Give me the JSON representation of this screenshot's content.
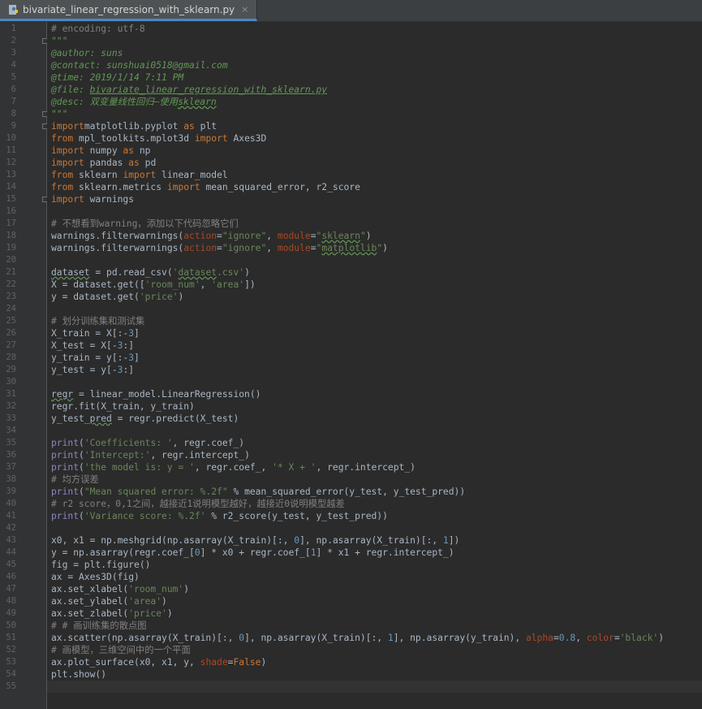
{
  "tab": {
    "title": "bivariate_linear_regression_with_sklearn.py",
    "close_glyph": "×",
    "icon": "python-file-icon"
  },
  "editor": {
    "current_line": 55,
    "lines": [
      {
        "n": "1",
        "tokens": [
          [
            "c-com",
            "# encoding: utf-8"
          ]
        ]
      },
      {
        "n": "2",
        "tokens": [
          [
            "c-doc",
            "\"\"\""
          ]
        ]
      },
      {
        "n": "3",
        "tokens": [
          [
            "c-doctag",
            "@author: suns"
          ]
        ]
      },
      {
        "n": "4",
        "tokens": [
          [
            "c-doctag",
            "@contact: sunshuai0518@gmail.com"
          ]
        ]
      },
      {
        "n": "5",
        "tokens": [
          [
            "c-doctag",
            "@time: 2019/1/14 7:11 PM"
          ]
        ]
      },
      {
        "n": "6",
        "tokens": [
          [
            "c-doctag",
            "@file: "
          ],
          [
            "c-doctag c-under",
            "bivariate_linear_regression_with_sklearn.py"
          ]
        ]
      },
      {
        "n": "7",
        "tokens": [
          [
            "c-doctag",
            "@desc: 双变量线性回归—使用"
          ],
          [
            "c-doctag c-wavy",
            "sklearn"
          ]
        ]
      },
      {
        "n": "8",
        "tokens": [
          [
            "c-doc",
            "\"\"\""
          ]
        ]
      },
      {
        "n": "9",
        "tokens": [
          [
            "c-kw",
            "import"
          ],
          [
            "",
            "matplotlib.pyplot "
          ],
          [
            "c-kw",
            "as"
          ],
          [
            "",
            " plt"
          ]
        ]
      },
      {
        "n": "10",
        "tokens": [
          [
            "c-kw",
            "from"
          ],
          [
            "",
            " mpl_toolkits.mplot3d "
          ],
          [
            "c-kw",
            "import"
          ],
          [
            "",
            " Axes3D"
          ]
        ]
      },
      {
        "n": "11",
        "tokens": [
          [
            "c-kw",
            "import"
          ],
          [
            "",
            " numpy "
          ],
          [
            "c-kw",
            "as"
          ],
          [
            "",
            " np"
          ]
        ]
      },
      {
        "n": "12",
        "tokens": [
          [
            "c-kw",
            "import"
          ],
          [
            "",
            " pandas "
          ],
          [
            "c-kw",
            "as"
          ],
          [
            "",
            " pd"
          ]
        ]
      },
      {
        "n": "13",
        "tokens": [
          [
            "c-kw",
            "from"
          ],
          [
            "",
            " sklearn "
          ],
          [
            "c-kw",
            "import"
          ],
          [
            "",
            " linear_model"
          ]
        ]
      },
      {
        "n": "14",
        "tokens": [
          [
            "c-kw",
            "from"
          ],
          [
            "",
            " sklearn.metrics "
          ],
          [
            "c-kw",
            "import"
          ],
          [
            "",
            " mean_squared_error, r2_score"
          ]
        ]
      },
      {
        "n": "15",
        "tokens": [
          [
            "c-kw",
            "import"
          ],
          [
            "",
            " warnings"
          ]
        ]
      },
      {
        "n": "16",
        "tokens": []
      },
      {
        "n": "17",
        "tokens": [
          [
            "c-com",
            "# 不想看到warning，添加以下代码忽略它们"
          ]
        ]
      },
      {
        "n": "18",
        "tokens": [
          [
            "",
            "warnings.filterwarnings("
          ],
          [
            "c-param",
            "action"
          ],
          [
            "",
            "="
          ],
          [
            "c-str",
            "\"ignore\""
          ],
          [
            ", ",
            ""
          ],
          [
            "",
            ", "
          ],
          [
            "c-param",
            "module"
          ],
          [
            "",
            "="
          ],
          [
            "c-str",
            "\""
          ],
          [
            "c-str c-wavy",
            "sklearn"
          ],
          [
            "c-str",
            "\""
          ],
          [
            "",
            ")"
          ]
        ]
      },
      {
        "n": "19",
        "tokens": [
          [
            "",
            "warnings.filterwarnings("
          ],
          [
            "c-param",
            "action"
          ],
          [
            "",
            "="
          ],
          [
            "c-str",
            "\"ignore\""
          ],
          [
            "",
            ", "
          ],
          [
            "c-param",
            "module"
          ],
          [
            "",
            "="
          ],
          [
            "c-str",
            "\""
          ],
          [
            "c-str c-wavy",
            "matplotlib"
          ],
          [
            "c-str",
            "\""
          ],
          [
            "",
            ")"
          ]
        ]
      },
      {
        "n": "20",
        "tokens": []
      },
      {
        "n": "21",
        "tokens": [
          [
            "c-wavy",
            "dataset"
          ],
          [
            "",
            " = pd.read_csv("
          ],
          [
            "c-str",
            "'"
          ],
          [
            "c-str c-wavy",
            "dataset"
          ],
          [
            "c-str",
            ".csv'"
          ],
          [
            "",
            ")"
          ]
        ]
      },
      {
        "n": "22",
        "tokens": [
          [
            "",
            "X = dataset.get(["
          ],
          [
            "c-str",
            "'room_num'"
          ],
          [
            "",
            ", "
          ],
          [
            "c-str",
            "'area'"
          ],
          [
            "",
            "])"
          ]
        ]
      },
      {
        "n": "23",
        "tokens": [
          [
            "",
            "y = dataset.get("
          ],
          [
            "c-str",
            "'price'"
          ],
          [
            "",
            ")"
          ]
        ]
      },
      {
        "n": "24",
        "tokens": []
      },
      {
        "n": "25",
        "tokens": [
          [
            "c-com",
            "# 划分训练集和测试集"
          ]
        ]
      },
      {
        "n": "26",
        "tokens": [
          [
            "",
            "X_train = X[:-"
          ],
          [
            "c-num",
            "3"
          ],
          [
            "",
            "]"
          ]
        ]
      },
      {
        "n": "27",
        "tokens": [
          [
            "",
            "X_test = X[-"
          ],
          [
            "c-num",
            "3"
          ],
          [
            "",
            ":]"
          ]
        ]
      },
      {
        "n": "28",
        "tokens": [
          [
            "",
            "y_train = y[:-"
          ],
          [
            "c-num",
            "3"
          ],
          [
            "",
            "]"
          ]
        ]
      },
      {
        "n": "29",
        "tokens": [
          [
            "",
            "y_test = y[-"
          ],
          [
            "c-num",
            "3"
          ],
          [
            "",
            ":]"
          ]
        ]
      },
      {
        "n": "30",
        "tokens": []
      },
      {
        "n": "31",
        "tokens": [
          [
            "c-wavy",
            "regr"
          ],
          [
            "",
            " = linear_model.LinearRegression()"
          ]
        ]
      },
      {
        "n": "32",
        "tokens": [
          [
            "",
            "regr.fit(X_train, y_train)"
          ]
        ]
      },
      {
        "n": "33",
        "tokens": [
          [
            "",
            "y_test_"
          ],
          [
            "c-wavy",
            "pred"
          ],
          [
            "",
            " = regr.predict(X_test)"
          ]
        ]
      },
      {
        "n": "34",
        "tokens": []
      },
      {
        "n": "35",
        "tokens": [
          [
            "c-builtin",
            "print"
          ],
          [
            "",
            "("
          ],
          [
            "c-str",
            "'Coefficients: '"
          ],
          [
            "",
            ", regr.coef_)"
          ]
        ]
      },
      {
        "n": "36",
        "tokens": [
          [
            "c-builtin",
            "print"
          ],
          [
            "",
            "("
          ],
          [
            "c-str",
            "'Intercept:'"
          ],
          [
            "",
            ", regr.intercept_)"
          ]
        ]
      },
      {
        "n": "37",
        "tokens": [
          [
            "c-builtin",
            "print"
          ],
          [
            "",
            "("
          ],
          [
            "c-str",
            "'the model is: y = '"
          ],
          [
            "",
            ", regr.coef_, "
          ],
          [
            "c-str",
            "'* X + '"
          ],
          [
            "",
            ", regr.intercept_)"
          ]
        ]
      },
      {
        "n": "38",
        "tokens": [
          [
            "c-com",
            "# 均方误差"
          ]
        ]
      },
      {
        "n": "39",
        "tokens": [
          [
            "c-builtin",
            "print"
          ],
          [
            "",
            "("
          ],
          [
            "c-str",
            "\"Mean squared error: %.2f\""
          ],
          [
            "",
            " % mean_squared_error(y_test, y_test_pred))"
          ]
        ]
      },
      {
        "n": "40",
        "tokens": [
          [
            "c-com",
            "# r2 score，0,1之间，越接近1说明模型越好，越接近0说明模型越差"
          ]
        ]
      },
      {
        "n": "41",
        "tokens": [
          [
            "c-builtin",
            "print"
          ],
          [
            "",
            "("
          ],
          [
            "c-str",
            "'Variance score: %.2f'"
          ],
          [
            "",
            " % r2_score(y_test, y_test_pred))"
          ]
        ]
      },
      {
        "n": "42",
        "tokens": []
      },
      {
        "n": "43",
        "tokens": [
          [
            "",
            "x0, x1 = np.meshgrid(np.asarray(X_train)[:, "
          ],
          [
            "c-num",
            "0"
          ],
          [
            "",
            "], np.asarray(X_train)[:, "
          ],
          [
            "c-num",
            "1"
          ],
          [
            "",
            "])"
          ]
        ]
      },
      {
        "n": "44",
        "tokens": [
          [
            "",
            "y = np.asarray(regr.coef_["
          ],
          [
            "c-num",
            "0"
          ],
          [
            "",
            "] * x0 + regr.coef_["
          ],
          [
            "c-num",
            "1"
          ],
          [
            "",
            "] * x1 + regr.intercept_)"
          ]
        ]
      },
      {
        "n": "45",
        "tokens": [
          [
            "",
            "fig = plt.figure()"
          ]
        ]
      },
      {
        "n": "46",
        "tokens": [
          [
            "",
            "ax = Axes3D(fig)"
          ]
        ]
      },
      {
        "n": "47",
        "tokens": [
          [
            "",
            "ax.set_xlabel("
          ],
          [
            "c-str",
            "'room_num'"
          ],
          [
            "",
            ")"
          ]
        ]
      },
      {
        "n": "48",
        "tokens": [
          [
            "",
            "ax.set_ylabel("
          ],
          [
            "c-str",
            "'area'"
          ],
          [
            "",
            ")"
          ]
        ]
      },
      {
        "n": "49",
        "tokens": [
          [
            "",
            "ax.set_zlabel("
          ],
          [
            "c-str",
            "'price'"
          ],
          [
            "",
            ")"
          ]
        ]
      },
      {
        "n": "50",
        "tokens": [
          [
            "c-com",
            "# # 画训练集的散点图"
          ]
        ]
      },
      {
        "n": "51",
        "tokens": [
          [
            "",
            "ax.scatter(np.asarray(X_train)[:, "
          ],
          [
            "c-num",
            "0"
          ],
          [
            "",
            "], np.asarray(X_train)[:, "
          ],
          [
            "c-num",
            "1"
          ],
          [
            "",
            "], np.asarray(y_train), "
          ],
          [
            "c-param",
            "alpha"
          ],
          [
            "",
            "="
          ],
          [
            "c-num",
            "0.8"
          ],
          [
            "",
            ", "
          ],
          [
            "c-param",
            "color"
          ],
          [
            "",
            "="
          ],
          [
            "c-str",
            "'black'"
          ],
          [
            "",
            ")"
          ]
        ]
      },
      {
        "n": "52",
        "tokens": [
          [
            "c-com",
            "# 画模型，三维空间中的一个平面"
          ]
        ]
      },
      {
        "n": "53",
        "tokens": [
          [
            "",
            "ax.plot_surface(x0, x1, y, "
          ],
          [
            "c-param",
            "shade"
          ],
          [
            "",
            "="
          ],
          [
            "c-kw",
            "False"
          ],
          [
            "",
            ")"
          ]
        ]
      },
      {
        "n": "54",
        "tokens": [
          [
            "",
            "plt.show()"
          ]
        ]
      },
      {
        "n": "55",
        "tokens": []
      }
    ]
  }
}
